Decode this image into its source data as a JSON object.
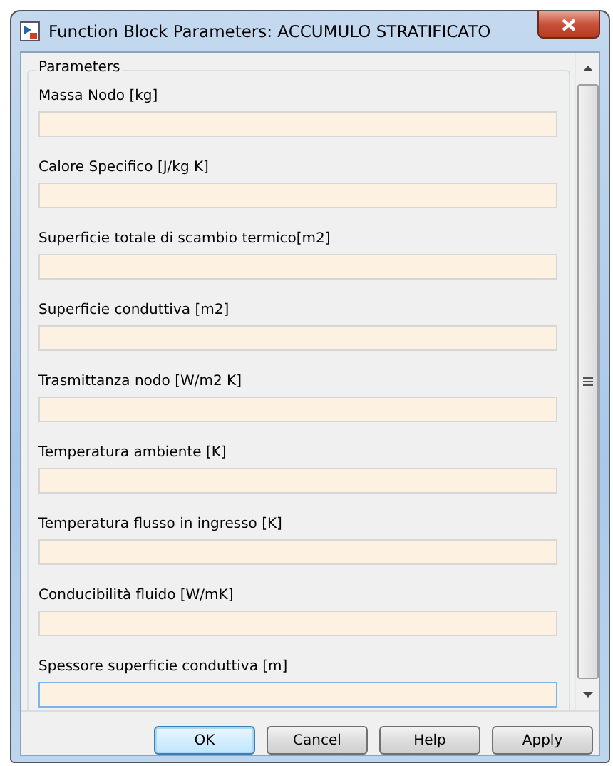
{
  "window": {
    "title": "Function Block Parameters: ACCUMULO STRATIFICATO"
  },
  "group": {
    "title": "Parameters"
  },
  "fields": [
    {
      "label": "Massa Nodo [kg]",
      "focused": false
    },
    {
      "label": "Calore Specifico [J/kg K]",
      "focused": false
    },
    {
      "label": "Superficie totale di scambio termico[m2]",
      "focused": false
    },
    {
      "label": "Superficie conduttiva [m2]",
      "focused": false
    },
    {
      "label": "Trasmittanza nodo [W/m2 K]",
      "focused": false
    },
    {
      "label": "Temperatura ambiente [K]",
      "focused": false
    },
    {
      "label": "Temperatura flusso in ingresso [K]",
      "focused": false
    },
    {
      "label": "Conducibilità fluido [W/mK]",
      "focused": false
    },
    {
      "label": "Spessore superficie conduttiva [m]",
      "focused": true
    }
  ],
  "buttons": [
    {
      "label": "OK",
      "default": true
    },
    {
      "label": "Cancel",
      "default": false
    },
    {
      "label": "Help",
      "default": false
    },
    {
      "label": "Apply",
      "default": false
    }
  ]
}
